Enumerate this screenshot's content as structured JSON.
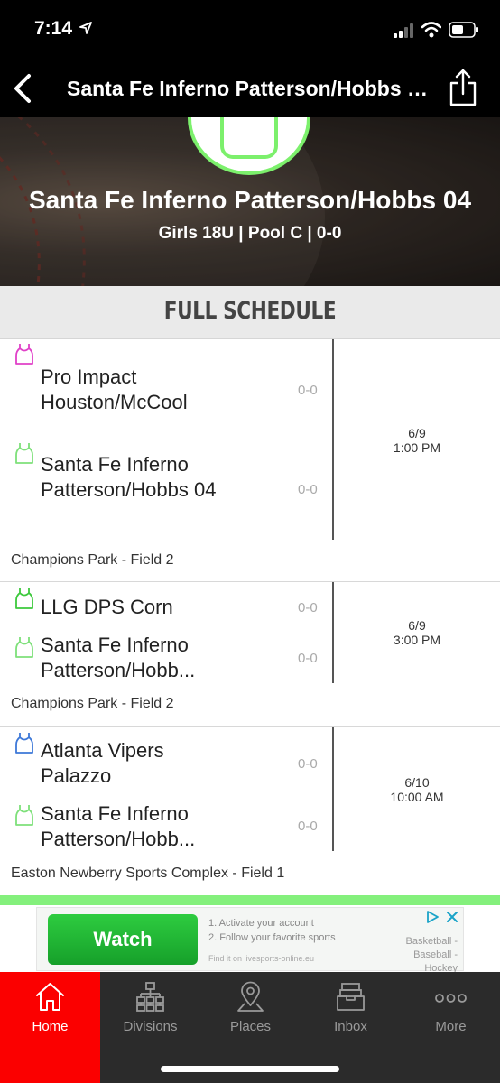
{
  "status_bar": {
    "time": "7:14"
  },
  "nav": {
    "title": "Santa Fe Inferno Patterson/Hobbs 04"
  },
  "hero": {
    "team_name": "Santa Fe Inferno Patterson/Hobbs 04",
    "subtitle": "Girls 18U | Pool C | 0-0"
  },
  "section": {
    "title": "FULL SCHEDULE"
  },
  "games": [
    {
      "home": {
        "name": "Pro Impact Houston/McCool",
        "score": "0-0",
        "jersey_color": "#e040c8"
      },
      "away": {
        "name": "Santa Fe Inferno Patterson/Hobbs 04",
        "score": "0-0",
        "jersey_color": "#7ee07a"
      },
      "date": "6/9",
      "time": "1:00 PM",
      "venue": "Champions Park - Field 2"
    },
    {
      "home": {
        "name": "LLG DPS Corn",
        "score": "0-0",
        "jersey_color": "#3cc93c"
      },
      "away": {
        "name": "Santa Fe Inferno Patterson/Hobb...",
        "score": "0-0",
        "jersey_color": "#7ee07a"
      },
      "date": "6/9",
      "time": "3:00 PM",
      "venue": "Champions Park - Field 2"
    },
    {
      "home": {
        "name": "Atlanta Vipers Palazzo",
        "score": "0-0",
        "jersey_color": "#3d78d8"
      },
      "away": {
        "name": "Santa Fe Inferno Patterson/Hobb...",
        "score": "0-0",
        "jersey_color": "#7ee07a"
      },
      "date": "6/10",
      "time": "10:00 AM",
      "venue": "Easton Newberry Sports Complex - Field 1"
    }
  ],
  "ad": {
    "button_label": "Watch",
    "line1": "1. Activate your account",
    "line2": "2. Follow your favorite sports",
    "line3": "Find it on livesports-online.eu",
    "side_text": "Basketball - Baseball - Hockey"
  },
  "tabs": [
    {
      "label": "Home",
      "icon": "home-icon",
      "active": true
    },
    {
      "label": "Divisions",
      "icon": "bracket-icon",
      "active": false
    },
    {
      "label": "Places",
      "icon": "map-pin-icon",
      "active": false
    },
    {
      "label": "Inbox",
      "icon": "inbox-icon",
      "active": false
    },
    {
      "label": "More",
      "icon": "more-dots-icon",
      "active": false
    }
  ],
  "colors": {
    "accent_green": "#84f07c",
    "active_tab": "#fb0000",
    "tab_bar": "#2b2b2b"
  }
}
